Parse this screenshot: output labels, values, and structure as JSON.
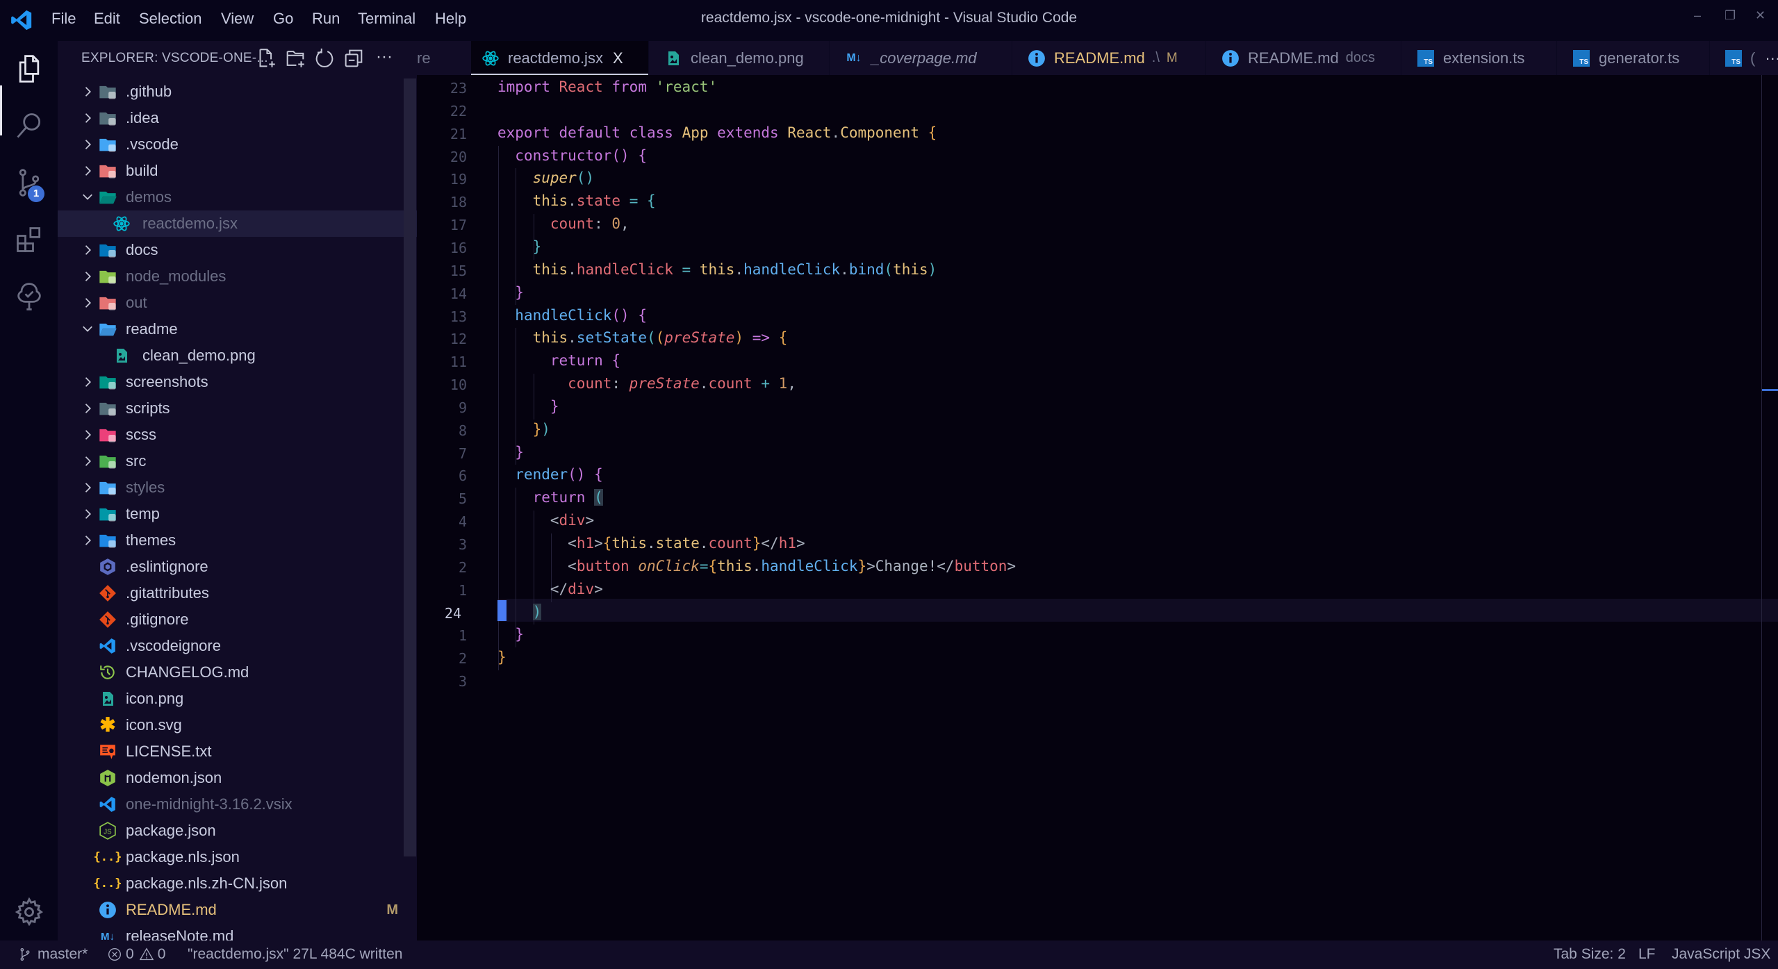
{
  "titlebar": {
    "menu": [
      "File",
      "Edit",
      "Selection",
      "View",
      "Go",
      "Run",
      "Terminal",
      "Help"
    ],
    "window_title": "reactdemo.jsx - vscode-one-midnight - Visual Studio Code",
    "controls": {
      "minimize": "–",
      "restore": "❐",
      "close": "✕"
    }
  },
  "activity_bar": {
    "items": [
      {
        "name": "explorer",
        "icon": "files-icon",
        "active": true
      },
      {
        "name": "search",
        "icon": "search-icon"
      },
      {
        "name": "source-control",
        "icon": "source-control-icon",
        "badge": "1"
      },
      {
        "name": "extensions",
        "icon": "extensions-icon"
      },
      {
        "name": "testing",
        "icon": "testing-tree-icon"
      }
    ],
    "settings_icon": "gear-icon"
  },
  "sidebar": {
    "title": "EXPLORER: VSCODE-ONE-...",
    "toolbar": [
      "new-file-icon",
      "new-folder-icon",
      "refresh-icon",
      "collapse-all-icon",
      "more-icon"
    ],
    "more_label": "···",
    "tree": [
      {
        "label": ".github",
        "type": "folder",
        "expanded": false,
        "depth": 0,
        "icon": "folder-github-icon",
        "color": "#546e7a"
      },
      {
        "label": ".idea",
        "type": "folder",
        "expanded": false,
        "depth": 0,
        "icon": "folder-idea-icon",
        "color": "#546e7a"
      },
      {
        "label": ".vscode",
        "type": "folder",
        "expanded": false,
        "depth": 0,
        "icon": "folder-vscode-icon",
        "color": "#42a5f5"
      },
      {
        "label": "build",
        "type": "folder",
        "expanded": false,
        "depth": 0,
        "icon": "folder-build-icon",
        "color": "#e57373"
      },
      {
        "label": "demos",
        "type": "folder",
        "expanded": true,
        "depth": 0,
        "icon": "folder-demo-icon",
        "color": "#009688",
        "dim": true
      },
      {
        "label": "reactdemo.jsx",
        "type": "file",
        "depth": 1,
        "icon": "react-icon",
        "color": "#00bcd4",
        "selected": true,
        "dim": true
      },
      {
        "label": "docs",
        "type": "folder",
        "expanded": false,
        "depth": 0,
        "icon": "folder-docs-icon",
        "color": "#0277bd"
      },
      {
        "label": "node_modules",
        "type": "folder",
        "expanded": false,
        "depth": 0,
        "icon": "folder-node-icon",
        "color": "#8bc34a",
        "dim": true
      },
      {
        "label": "out",
        "type": "folder",
        "expanded": false,
        "depth": 0,
        "icon": "folder-dist-icon",
        "color": "#e57373",
        "dim": true
      },
      {
        "label": "readme",
        "type": "folder",
        "expanded": true,
        "depth": 0,
        "icon": "folder-open-icon",
        "color": "#42a5f5"
      },
      {
        "label": "clean_demo.png",
        "type": "file",
        "depth": 1,
        "icon": "image-icon",
        "color": "#26a69a"
      },
      {
        "label": "screenshots",
        "type": "folder",
        "expanded": false,
        "depth": 0,
        "icon": "folder-images-icon",
        "color": "#009688"
      },
      {
        "label": "scripts",
        "type": "folder",
        "expanded": false,
        "depth": 0,
        "icon": "folder-scripts-icon",
        "color": "#546e7a"
      },
      {
        "label": "scss",
        "type": "folder",
        "expanded": false,
        "depth": 0,
        "icon": "folder-sass-icon",
        "color": "#ec407a"
      },
      {
        "label": "src",
        "type": "folder",
        "expanded": false,
        "depth": 0,
        "icon": "folder-src-icon",
        "color": "#4caf50"
      },
      {
        "label": "styles",
        "type": "folder",
        "expanded": false,
        "depth": 0,
        "icon": "folder-css-icon",
        "color": "#42a5f5",
        "dim": true
      },
      {
        "label": "temp",
        "type": "folder",
        "expanded": false,
        "depth": 0,
        "icon": "folder-temp-icon",
        "color": "#0097a7"
      },
      {
        "label": "themes",
        "type": "folder",
        "expanded": false,
        "depth": 0,
        "icon": "folder-theme-icon",
        "color": "#1e88e5"
      },
      {
        "label": ".eslintignore",
        "type": "file",
        "depth": 0,
        "icon": "eslint-icon",
        "color": "#5c6bc0"
      },
      {
        "label": ".gitattributes",
        "type": "file",
        "depth": 0,
        "icon": "git-icon",
        "color": "#e64a19"
      },
      {
        "label": ".gitignore",
        "type": "file",
        "depth": 0,
        "icon": "git-icon",
        "color": "#e64a19"
      },
      {
        "label": ".vscodeignore",
        "type": "file",
        "depth": 0,
        "icon": "vscode-icon",
        "color": "#2196f3"
      },
      {
        "label": "CHANGELOG.md",
        "type": "file",
        "depth": 0,
        "icon": "changelog-icon",
        "color": "#8bc34a"
      },
      {
        "label": "icon.png",
        "type": "file",
        "depth": 0,
        "icon": "image-icon",
        "color": "#26a69a"
      },
      {
        "label": "icon.svg",
        "type": "file",
        "depth": 0,
        "icon": "svg-icon",
        "color": "#ffb300"
      },
      {
        "label": "LICENSE.txt",
        "type": "file",
        "depth": 0,
        "icon": "license-icon",
        "color": "#ff5722"
      },
      {
        "label": "nodemon.json",
        "type": "file",
        "depth": 0,
        "icon": "nodemon-icon",
        "color": "#8bc34a"
      },
      {
        "label": "one-midnight-3.16.2.vsix",
        "type": "file",
        "depth": 0,
        "icon": "vscode-icon",
        "color": "#2196f3",
        "dim": true
      },
      {
        "label": "package.json",
        "type": "file",
        "depth": 0,
        "icon": "nodejs-icon",
        "color": "#8bc34a"
      },
      {
        "label": "package.nls.json",
        "type": "file",
        "depth": 0,
        "icon": "json-icon",
        "color": "#fbc02d"
      },
      {
        "label": "package.nls.zh-CN.json",
        "type": "file",
        "depth": 0,
        "icon": "json-icon",
        "color": "#fbc02d"
      },
      {
        "label": "README.md",
        "type": "file",
        "depth": 0,
        "icon": "info-icon",
        "color": "#42a5f5",
        "modified": true,
        "badge": "M"
      },
      {
        "label": "releaseNote.md",
        "type": "file",
        "depth": 0,
        "icon": "markdown-icon",
        "color": "#42a5f5"
      }
    ]
  },
  "tabs": [
    {
      "label": "re",
      "partial": true
    },
    {
      "label": "reactdemo.jsx",
      "icon": "react-icon",
      "active": true,
      "close": "X"
    },
    {
      "label": "clean_demo.png",
      "icon": "image-icon"
    },
    {
      "label": "_coverpage.md",
      "icon": "markdown-icon",
      "icon_text": "M↓",
      "italic": true
    },
    {
      "label": "README.md",
      "icon": "info-icon",
      "sub": ".\\",
      "mod": "M",
      "modified": true
    },
    {
      "label": "README.md",
      "icon": "info-icon",
      "sub": "docs"
    },
    {
      "label": "extension.ts",
      "icon": "typescript-icon",
      "icon_text": "TS"
    },
    {
      "label": "generator.ts",
      "icon": "typescript-icon",
      "icon_text": "TS"
    },
    {
      "label": "(",
      "icon": "typescript-icon",
      "icon_text": "TS",
      "partial": true
    }
  ],
  "tab_overflow": "···",
  "editor": {
    "line_numbers": [
      "23",
      "22",
      "21",
      "20",
      "19",
      "18",
      "17",
      "16",
      "15",
      "14",
      "13",
      "12",
      "11",
      "10",
      "9",
      "8",
      "7",
      "6",
      "5",
      "4",
      "3",
      "2",
      "1",
      "24",
      "1",
      "2",
      "3"
    ],
    "current_line_index": 23,
    "lines": [
      [
        [
          "k",
          "import"
        ],
        [
          "p",
          " "
        ],
        [
          "v",
          "React"
        ],
        [
          "p",
          " "
        ],
        [
          "k",
          "from"
        ],
        [
          "p",
          " "
        ],
        [
          "s",
          "'react'"
        ]
      ],
      [],
      [
        [
          "k",
          "export"
        ],
        [
          "p",
          " "
        ],
        [
          "k",
          "default"
        ],
        [
          "p",
          " "
        ],
        [
          "k",
          "class"
        ],
        [
          "p",
          " "
        ],
        [
          "c",
          "App"
        ],
        [
          "p",
          " "
        ],
        [
          "k",
          "extends"
        ],
        [
          "p",
          " "
        ],
        [
          "c",
          "React"
        ],
        [
          "p",
          "."
        ],
        [
          "c",
          "Component"
        ],
        [
          "p",
          " "
        ],
        [
          "b1",
          "{"
        ]
      ],
      [
        [
          "p",
          "  "
        ],
        [
          "k",
          "constructor"
        ],
        [
          "b2",
          "()"
        ],
        [
          "p",
          " "
        ],
        [
          "b2",
          "{"
        ]
      ],
      [
        [
          "p",
          "    "
        ],
        [
          "c i",
          "super"
        ],
        [
          "b3",
          "()"
        ]
      ],
      [
        [
          "p",
          "    "
        ],
        [
          "c",
          "this"
        ],
        [
          "p",
          "."
        ],
        [
          "v",
          "state"
        ],
        [
          "p",
          " "
        ],
        [
          "o",
          "="
        ],
        [
          "p",
          " "
        ],
        [
          "b3",
          "{"
        ]
      ],
      [
        [
          "p",
          "      "
        ],
        [
          "v",
          "count"
        ],
        [
          "p",
          ": "
        ],
        [
          "n",
          "0"
        ],
        [
          "p",
          ","
        ]
      ],
      [
        [
          "p",
          "    "
        ],
        [
          "b3",
          "}"
        ]
      ],
      [
        [
          "p",
          "    "
        ],
        [
          "c",
          "this"
        ],
        [
          "p",
          "."
        ],
        [
          "v",
          "handleClick"
        ],
        [
          "p",
          " "
        ],
        [
          "o",
          "="
        ],
        [
          "p",
          " "
        ],
        [
          "c",
          "this"
        ],
        [
          "p",
          "."
        ],
        [
          "f",
          "handleClick"
        ],
        [
          "p",
          "."
        ],
        [
          "f",
          "bind"
        ],
        [
          "b3",
          "("
        ],
        [
          "c",
          "this"
        ],
        [
          "b3",
          ")"
        ]
      ],
      [
        [
          "p",
          "  "
        ],
        [
          "b2",
          "}"
        ]
      ],
      [
        [
          "p",
          "  "
        ],
        [
          "f",
          "handleClick"
        ],
        [
          "b2",
          "()"
        ],
        [
          "p",
          " "
        ],
        [
          "b2",
          "{"
        ]
      ],
      [
        [
          "p",
          "    "
        ],
        [
          "c",
          "this"
        ],
        [
          "p",
          "."
        ],
        [
          "f",
          "setState"
        ],
        [
          "b3",
          "("
        ],
        [
          "b1",
          "("
        ],
        [
          "v i",
          "preState"
        ],
        [
          "b1",
          ")"
        ],
        [
          "p",
          " "
        ],
        [
          "k",
          "=>"
        ],
        [
          "p",
          " "
        ],
        [
          "b1",
          "{"
        ]
      ],
      [
        [
          "p",
          "      "
        ],
        [
          "k",
          "return"
        ],
        [
          "p",
          " "
        ],
        [
          "b2",
          "{"
        ]
      ],
      [
        [
          "p",
          "        "
        ],
        [
          "v",
          "count"
        ],
        [
          "p",
          ": "
        ],
        [
          "v i",
          "preState"
        ],
        [
          "p",
          "."
        ],
        [
          "v",
          "count"
        ],
        [
          "p",
          " "
        ],
        [
          "o",
          "+"
        ],
        [
          "p",
          " "
        ],
        [
          "n",
          "1"
        ],
        [
          "p",
          ","
        ]
      ],
      [
        [
          "p",
          "      "
        ],
        [
          "b2",
          "}"
        ]
      ],
      [
        [
          "p",
          "    "
        ],
        [
          "b1",
          "}"
        ],
        [
          "b3",
          ")"
        ]
      ],
      [
        [
          "p",
          "  "
        ],
        [
          "b2",
          "}"
        ]
      ],
      [
        [
          "p",
          "  "
        ],
        [
          "f",
          "render"
        ],
        [
          "b2",
          "()"
        ],
        [
          "p",
          " "
        ],
        [
          "b2",
          "{"
        ]
      ],
      [
        [
          "p",
          "    "
        ],
        [
          "k",
          "return"
        ],
        [
          "p",
          " "
        ],
        [
          "b3 bm",
          "("
        ]
      ],
      [
        [
          "p",
          "      "
        ],
        [
          "p",
          "<"
        ],
        [
          "v",
          "div"
        ],
        [
          "p",
          ">"
        ]
      ],
      [
        [
          "p",
          "        "
        ],
        [
          "p",
          "<"
        ],
        [
          "v",
          "h1"
        ],
        [
          "p",
          ">"
        ],
        [
          "b1",
          "{"
        ],
        [
          "c",
          "this"
        ],
        [
          "p",
          "."
        ],
        [
          "c",
          "state"
        ],
        [
          "p",
          "."
        ],
        [
          "v",
          "count"
        ],
        [
          "b1",
          "}"
        ],
        [
          "p",
          "</"
        ],
        [
          "v",
          "h1"
        ],
        [
          "p",
          ">"
        ]
      ],
      [
        [
          "p",
          "        "
        ],
        [
          "p",
          "<"
        ],
        [
          "v",
          "button"
        ],
        [
          "p",
          " "
        ],
        [
          "n i",
          "onClick"
        ],
        [
          "o",
          "="
        ],
        [
          "b1",
          "{"
        ],
        [
          "c",
          "this"
        ],
        [
          "p",
          "."
        ],
        [
          "f",
          "handleClick"
        ],
        [
          "b1",
          "}"
        ],
        [
          "p",
          ">Change!</"
        ],
        [
          "v",
          "button"
        ],
        [
          "p",
          ">"
        ]
      ],
      [
        [
          "p",
          "      "
        ],
        [
          "p",
          "</"
        ],
        [
          "v",
          "div"
        ],
        [
          "p",
          ">"
        ]
      ],
      [
        [
          "p",
          "    "
        ],
        [
          "b3 bm",
          ")"
        ]
      ],
      [
        [
          "p",
          "  "
        ],
        [
          "b2",
          "}"
        ]
      ],
      [
        [
          "b1",
          "}"
        ]
      ],
      []
    ]
  },
  "statusbar": {
    "branch": "master*",
    "errors": "0",
    "warnings": "0",
    "message": "\"reactdemo.jsx\" 27L 484C written",
    "tab_size": "Tab Size: 2",
    "eol": "LF",
    "language": "JavaScript JSX"
  }
}
